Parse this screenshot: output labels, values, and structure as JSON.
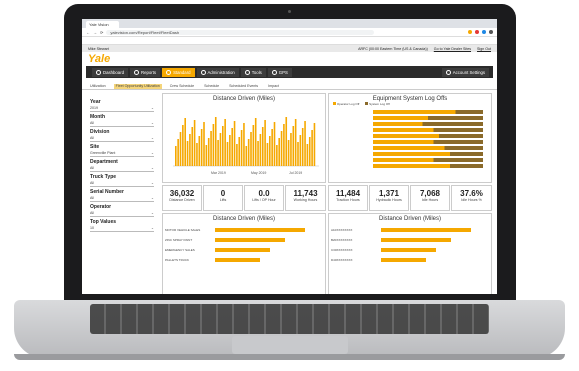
{
  "browser": {
    "tab_title": "Yale Vision",
    "url": "yalevision.com/Report/Fleet/FleetDash"
  },
  "app": {
    "user_name": "Mike Stewart",
    "logo_text": "Yale",
    "account_info": "ARFC (00:00 Eastern Time (US & Canada))",
    "go_to_link": "Go to Yale Dealer Sites",
    "signout": "Sign Out"
  },
  "nav": {
    "items": [
      "Dashboard",
      "Reports",
      "Standard",
      "Administration",
      "Tools",
      "GPS"
    ],
    "account": "Account Settings"
  },
  "subtabs": [
    "Utilization",
    "Fleet Opportunity Utilization",
    "Crew Schedule",
    "Schedule",
    "Scheduled Events",
    "Impact"
  ],
  "filters": [
    {
      "label": "Year",
      "value": "2019"
    },
    {
      "label": "Month",
      "value": "All"
    },
    {
      "label": "Division",
      "value": "All"
    },
    {
      "label": "Site",
      "value": "Greenville Plant"
    },
    {
      "label": "Department",
      "value": "All"
    },
    {
      "label": "Truck Type",
      "value": "All"
    },
    {
      "label": "Serial Number",
      "value": "All"
    },
    {
      "label": "Operator",
      "value": "All"
    },
    {
      "label": "Top Values",
      "value": "10"
    }
  ],
  "charts": {
    "distance_title": "Distance Driven (Miles)",
    "logoffs_title": "Equipment System Log Offs",
    "logoffs_legend": [
      "Operator Log Off",
      "System Log Off"
    ],
    "distance_x_ticks": [
      "Mar 2019",
      "May 2019",
      "Jul 2019"
    ],
    "distance_bottom_left_title": "Distance Driven (Miles)",
    "distance_bottom_right_title": "Distance Driven (Miles)",
    "bottom_left_rows": [
      "MOTOR VEHICLE SALES",
      "ZINC SPRAY PAINT",
      "EMERGENCY SALES",
      "PALLETS TRUCK"
    ],
    "bottom_right_rows": [
      "A10XXXXXXXX",
      "B20XXXXXXXX",
      "C30XXXXXXXX",
      "D40XXXXXXXX"
    ]
  },
  "kpis_left": [
    {
      "value": "36,032",
      "label": "Distance Driven"
    },
    {
      "value": "0",
      "label": "Lifts"
    },
    {
      "value": "0.0",
      "label": "Lifts / OP Hour"
    },
    {
      "value": "11,743",
      "label": "Working Hours"
    }
  ],
  "kpis_right": [
    {
      "value": "11,484",
      "label": "Traction Hours"
    },
    {
      "value": "1,371",
      "label": "Hydraulic Hours"
    },
    {
      "value": "7,068",
      "label": "Idle Hours"
    },
    {
      "value": "37.6%",
      "label": "Idle Hours %"
    }
  ],
  "colors": {
    "accent": "#f5a800",
    "dark": "#8a6a2a",
    "nav": "#2b2b2b"
  }
}
